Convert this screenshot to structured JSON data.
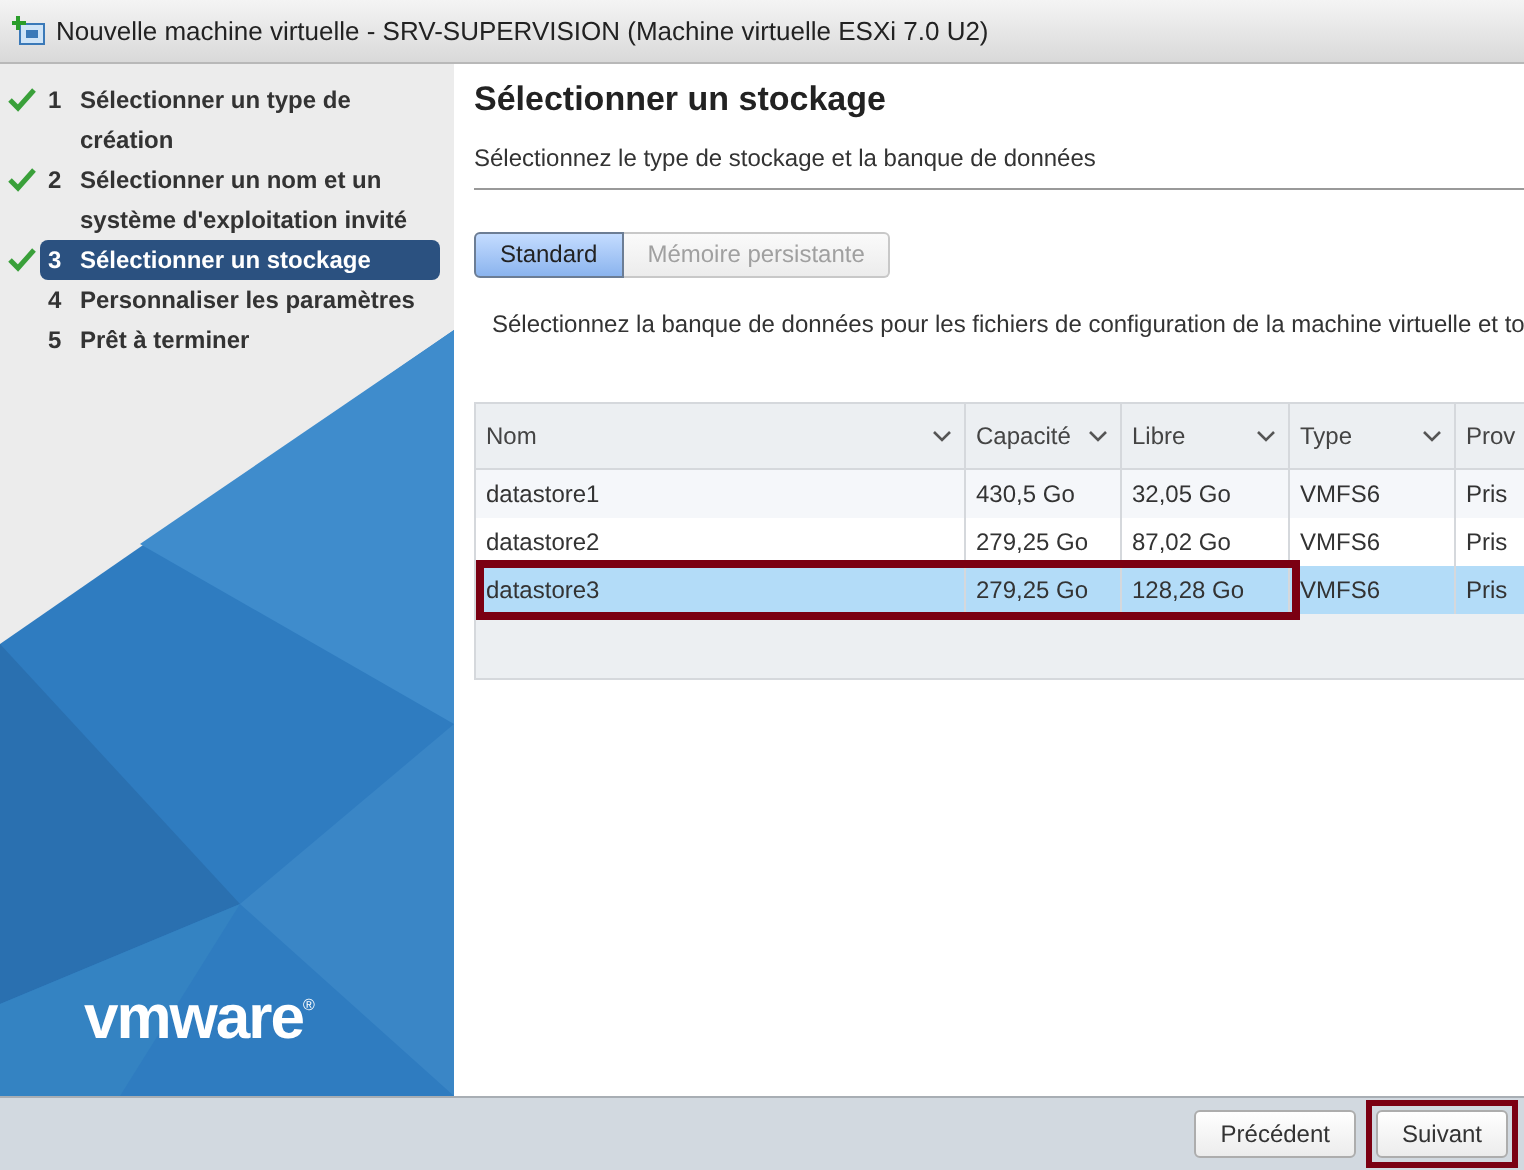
{
  "window": {
    "title": "Nouvelle machine virtuelle - SRV-SUPERVISION (Machine virtuelle ESXi 7.0 U2)"
  },
  "steps": [
    {
      "number": "1",
      "label": "Sélectionner un type de création",
      "done": true,
      "selected": false
    },
    {
      "number": "2",
      "label": "Sélectionner un nom et un système d'exploitation invité",
      "done": true,
      "selected": false
    },
    {
      "number": "3",
      "label": "Sélectionner un stockage",
      "done": true,
      "selected": true
    },
    {
      "number": "4",
      "label": "Personnaliser les paramètres",
      "done": false,
      "selected": false
    },
    {
      "number": "5",
      "label": "Prêt à terminer",
      "done": false,
      "selected": false
    }
  ],
  "logo": {
    "text": "vmware",
    "mark": "®"
  },
  "page": {
    "title": "Sélectionner un stockage",
    "subtitle": "Sélectionnez le type de stockage et la banque de données"
  },
  "tabs": [
    {
      "label": "Standard",
      "selected": true,
      "disabled": false
    },
    {
      "label": "Mémoire persistante",
      "selected": false,
      "disabled": true
    }
  ],
  "description": "Sélectionnez la banque de données pour les fichiers de configuration de la machine virtuelle et to",
  "table": {
    "columns": [
      {
        "label": "Nom"
      },
      {
        "label": "Capacité"
      },
      {
        "label": "Libre"
      },
      {
        "label": "Type"
      },
      {
        "label": "Prov"
      }
    ],
    "rows": [
      {
        "cells": [
          "datastore1",
          "430,5 Go",
          "32,05 Go",
          "VMFS6",
          "Pris"
        ],
        "selected": false,
        "highlighted": false
      },
      {
        "cells": [
          "datastore2",
          "279,25 Go",
          "87,02 Go",
          "VMFS6",
          "Pris"
        ],
        "selected": false,
        "highlighted": false
      },
      {
        "cells": [
          "datastore3",
          "279,25 Go",
          "128,28 Go",
          "VMFS6",
          "Pris"
        ],
        "selected": true,
        "highlighted": true
      }
    ]
  },
  "buttons": [
    {
      "label": "Précédent",
      "highlighted": false
    },
    {
      "label": "Suivant",
      "highlighted": true
    }
  ]
}
